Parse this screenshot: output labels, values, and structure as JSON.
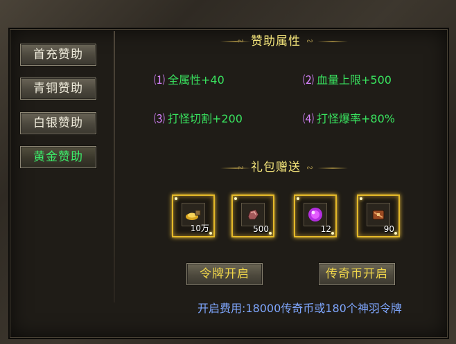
{
  "sidebar": {
    "items": [
      {
        "label": "首充赞助",
        "active": false
      },
      {
        "label": "青铜赞助",
        "active": false
      },
      {
        "label": "白银赞助",
        "active": false
      },
      {
        "label": "黄金赞助",
        "active": true
      }
    ]
  },
  "attributes": {
    "title": "赞助属性",
    "items": [
      {
        "num": "⑴",
        "text": "全属性+40"
      },
      {
        "num": "⑵",
        "text": "血量上限+500"
      },
      {
        "num": "⑶",
        "text": "打怪切割+200"
      },
      {
        "num": "⑷",
        "text": "打怪爆率+80%"
      }
    ]
  },
  "gifts": {
    "title": "礼包赠送",
    "items": [
      {
        "icon": "gold-ingot-icon",
        "count": "10万"
      },
      {
        "icon": "ore-icon",
        "count": "500"
      },
      {
        "icon": "purple-orb-icon",
        "count": "12"
      },
      {
        "icon": "token-chest-icon",
        "count": "90"
      }
    ]
  },
  "actions": {
    "token_open": "令牌开启",
    "coin_open": "传奇币开启"
  },
  "cost_text": "开启费用:18000传奇币或180个神羽令牌",
  "colors": {
    "active_green": "#3bf06a",
    "attr_green": "#39e35f",
    "number_purple": "#d884ff",
    "title_yellow": "#f2e37a",
    "gift_border_gold": "#e4b928",
    "cost_blue": "#7fa7ff"
  }
}
